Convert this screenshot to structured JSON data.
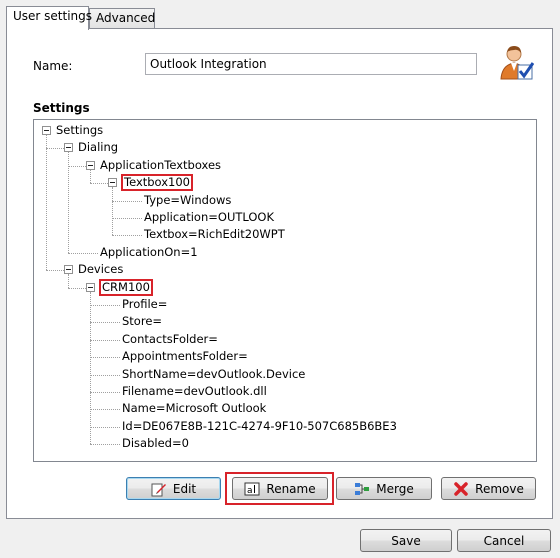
{
  "tabs": [
    {
      "label": "User settings",
      "active": true
    },
    {
      "label": "Advanced",
      "active": false
    }
  ],
  "name_label": "Name:",
  "name_value": "Outlook Integration",
  "settings_title": "Settings",
  "tree": [
    {
      "label": "Settings",
      "level": 0,
      "expanded": true
    },
    {
      "label": "Dialing",
      "level": 1,
      "expanded": true
    },
    {
      "label": "ApplicationTextboxes",
      "level": 2,
      "expanded": true
    },
    {
      "label": "Textbox100",
      "level": 3,
      "expanded": true,
      "highlighted": true
    },
    {
      "label": "Type=Windows",
      "level": 4
    },
    {
      "label": "Application=OUTLOOK",
      "level": 4
    },
    {
      "label": "Textbox=RichEdit20WPT",
      "level": 4
    },
    {
      "label": "ApplicationOn=1",
      "level": 2
    },
    {
      "label": "Devices",
      "level": 1,
      "expanded": true
    },
    {
      "label": "CRM100",
      "level": 2,
      "expanded": true,
      "highlighted": true
    },
    {
      "label": "Profile=",
      "level": 3
    },
    {
      "label": "Store=",
      "level": 3
    },
    {
      "label": "ContactsFolder=",
      "level": 3
    },
    {
      "label": "AppointmentsFolder=",
      "level": 3
    },
    {
      "label": "ShortName=devOutlook.Device",
      "level": 3
    },
    {
      "label": "Filename=devOutlook.dll",
      "level": 3
    },
    {
      "label": "Name=Microsoft Outlook",
      "level": 3
    },
    {
      "label": "Id=DE067E8B-121C-4274-9F10-507C685B6BE3",
      "level": 3
    },
    {
      "label": "Disabled=0",
      "level": 3
    }
  ],
  "buttons": {
    "edit": "Edit",
    "rename": "Rename",
    "merge": "Merge",
    "remove": "Remove",
    "save": "Save",
    "cancel": "Cancel"
  },
  "highlight_color": "#d8232a"
}
